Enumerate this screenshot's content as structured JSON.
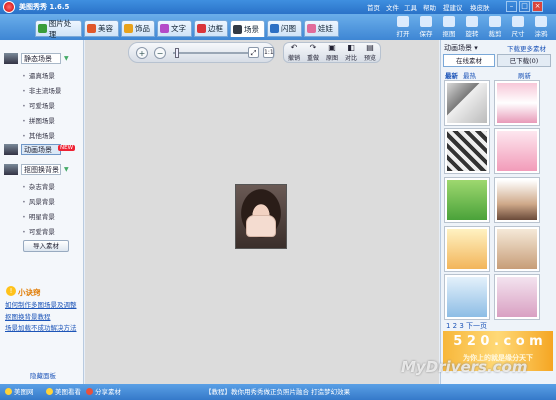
{
  "app": {
    "title": "美图秀秀 1.6.5"
  },
  "top_menu": [
    "首页",
    "文件",
    "工具",
    "帮助",
    "提建议",
    "换皮肤"
  ],
  "tabs": [
    {
      "label": "图片处理",
      "color": "#3a9d3a"
    },
    {
      "label": "美容",
      "color": "#e0572a"
    },
    {
      "label": "饰品",
      "color": "#e8a21b"
    },
    {
      "label": "文字",
      "color": "#b44ac8"
    },
    {
      "label": "边框",
      "color": "#d9343a"
    },
    {
      "label": "场景",
      "color": "#333a45"
    },
    {
      "label": "闪图",
      "color": "#2c6fc4"
    },
    {
      "label": "娃娃",
      "color": "#e06a9a"
    }
  ],
  "toolbar_buttons": [
    "打开",
    "保存",
    "抠图",
    "旋转",
    "裁剪",
    "尺寸",
    "涂鸦"
  ],
  "left_panel": {
    "category_static": "静态场景",
    "static_items": [
      "逼真场景",
      "非主流场景",
      "可爱场景",
      "拼图场景",
      "其他场景"
    ],
    "category_animated": "动画场景",
    "badge_new": "NEW",
    "category_bg": "抠图换背景",
    "bg_items": [
      "杂志背景",
      "风景背景",
      "明星背景",
      "可爱背景"
    ],
    "import_label": "导入素材",
    "tips_title": "小诀窍",
    "tips": [
      "如何制作多图场景及调整",
      "抠图换背景教程",
      "场景加载不成功解决方法"
    ],
    "hide_panel": "隐藏面板"
  },
  "canvas": {
    "zoom_in": "+",
    "zoom_out": "−",
    "fit": "⤢",
    "actual": "1:1",
    "edit_buttons": [
      "撤销",
      "重做",
      "原图",
      "对比",
      "预览"
    ]
  },
  "right_panel": {
    "title": "动画场景 ▾",
    "more_link": "下载更多素材",
    "tab_online": "在线素材",
    "tab_downloaded": "已下载(0)",
    "sort_new": "最新",
    "sort_hot": "最热",
    "refresh": "刷新",
    "pager": "1 2 3 下一页",
    "ad_text": "5 2 0 . c o m",
    "ad_sub": "为你上的就是缘分天下"
  },
  "watermark": "MyDrivers.com",
  "status_bar": {
    "left_items": [
      "美图网",
      "美图看看",
      "分享素材"
    ],
    "center_text": "【教程】教你用秀秀做正负照片融合 打造梦幻效果"
  }
}
